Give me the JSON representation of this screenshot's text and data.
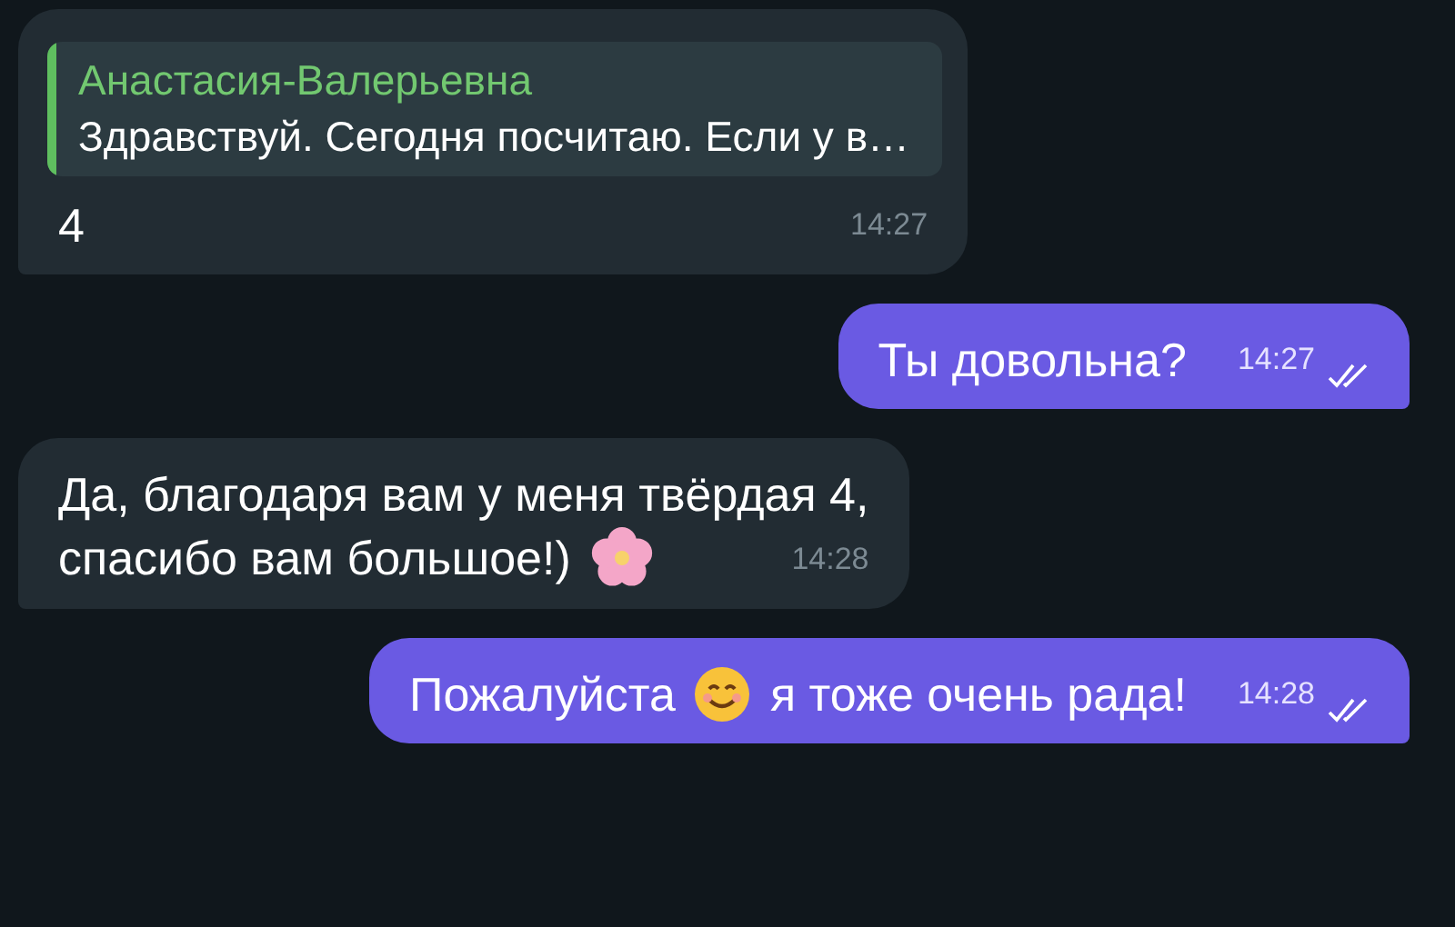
{
  "messages": [
    {
      "outgoing": false,
      "reply": {
        "author": "Анастасия-Валерьевна",
        "text": "Здравствуй. Сегодня посчитаю. Если у в…"
      },
      "lines": [
        [
          {
            "kind": "text",
            "text": "4"
          }
        ]
      ],
      "time": "14:27"
    },
    {
      "outgoing": true,
      "lines": [
        [
          {
            "kind": "text",
            "text": "Ты довольна?"
          }
        ]
      ],
      "time": "14:27",
      "read": true
    },
    {
      "outgoing": false,
      "lines": [
        [
          {
            "kind": "text",
            "text": "Да, благодаря вам у меня твёрдая 4,"
          }
        ],
        [
          {
            "kind": "text",
            "text": "спасибо вам большое!)"
          },
          {
            "kind": "flower"
          }
        ]
      ],
      "time": "14:28"
    },
    {
      "outgoing": true,
      "lines": [
        [
          {
            "kind": "text",
            "text": "Пожалуйста"
          },
          {
            "kind": "smile"
          },
          {
            "kind": "text",
            "text": "я тоже очень рада!"
          }
        ]
      ],
      "time": "14:28",
      "read": true
    }
  ]
}
